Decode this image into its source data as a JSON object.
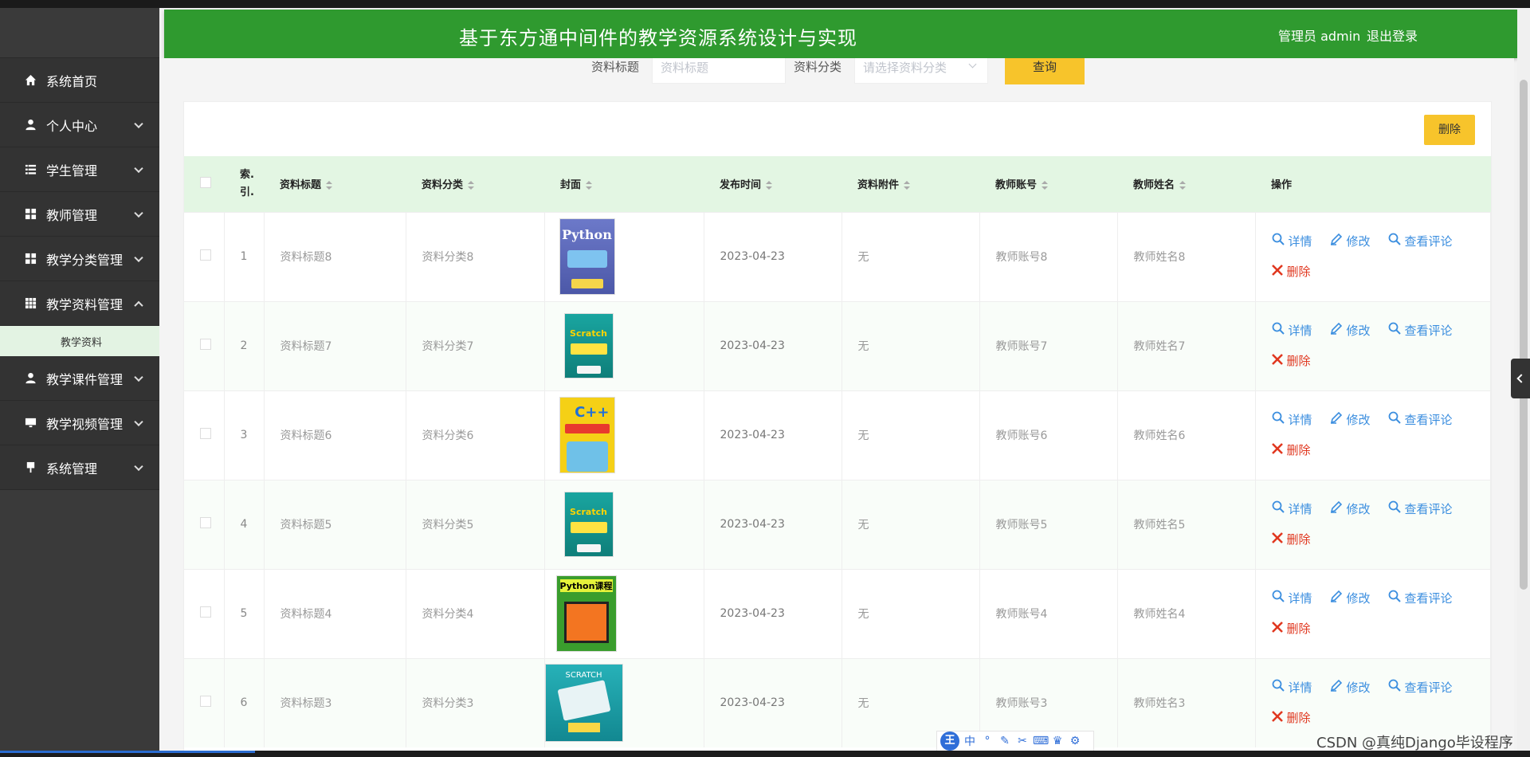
{
  "header": {
    "title": "基于东方通中间件的教学资源系统设计与实现",
    "user": "管理员 admin",
    "logout": "退出登录"
  },
  "sidebar": {
    "items": [
      {
        "label": "系统首页",
        "icon": "home-icon",
        "chevron": "none"
      },
      {
        "label": "个人中心",
        "icon": "person-icon",
        "chevron": "down"
      },
      {
        "label": "学生管理",
        "icon": "list-icon",
        "chevron": "down"
      },
      {
        "label": "教师管理",
        "icon": "grid-icon",
        "chevron": "down"
      },
      {
        "label": "教学分类管理",
        "icon": "grid-icon",
        "chevron": "down"
      },
      {
        "label": "教学资料管理",
        "icon": "table-icon",
        "chevron": "up"
      },
      {
        "label": "教学课件管理",
        "icon": "person-icon",
        "chevron": "down"
      },
      {
        "label": "教学视频管理",
        "icon": "monitor-icon",
        "chevron": "down"
      },
      {
        "label": "系统管理",
        "icon": "sign-icon",
        "chevron": "down"
      }
    ],
    "submenu_active": "教学资料"
  },
  "search": {
    "title_label": "资料标题",
    "title_placeholder": "资料标题",
    "category_label": "资料分类",
    "category_placeholder": "请选择资料分类",
    "query_button": "查询"
  },
  "toolbar": {
    "delete_label": "删除"
  },
  "table": {
    "headers": [
      "索.引.",
      "资料标题",
      "资料分类",
      "封面",
      "发布时间",
      "资料附件",
      "教师账号",
      "教师姓名",
      "操作"
    ],
    "index_line1": "索.",
    "index_line2": "引.",
    "rows": [
      {
        "index": "1",
        "title": "资料标题8",
        "category": "资料分类8",
        "cover": "Python",
        "date": "2023-04-23",
        "attachment": "无",
        "account": "教师账号8",
        "name": "教师姓名8"
      },
      {
        "index": "2",
        "title": "资料标题7",
        "category": "资料分类7",
        "cover": "Scratch",
        "date": "2023-04-23",
        "attachment": "无",
        "account": "教师账号7",
        "name": "教师姓名7"
      },
      {
        "index": "3",
        "title": "资料标题6",
        "category": "资料分类6",
        "cover": "C++",
        "date": "2023-04-23",
        "attachment": "无",
        "account": "教师账号6",
        "name": "教师姓名6"
      },
      {
        "index": "4",
        "title": "资料标题5",
        "category": "资料分类5",
        "cover": "Scratch",
        "date": "2023-04-23",
        "attachment": "无",
        "account": "教师账号5",
        "name": "教师姓名5"
      },
      {
        "index": "5",
        "title": "资料标题4",
        "category": "资料分类4",
        "cover": "Python课程",
        "date": "2023-04-23",
        "attachment": "无",
        "account": "教师账号4",
        "name": "教师姓名4"
      },
      {
        "index": "6",
        "title": "资料标题3",
        "category": "资料分类3",
        "cover": "SCRATCH",
        "date": "2023-04-23",
        "attachment": "无",
        "account": "教师账号3",
        "name": "教师姓名3"
      }
    ],
    "ops": {
      "detail": "详情",
      "edit": "修改",
      "comments": "查看评论",
      "delete": "删除"
    }
  },
  "ime": {
    "logo": "王",
    "mode": "中"
  },
  "watermark": "CSDN @真纯Django毕设程序",
  "colors": {
    "header_bg": "#2f9a2f",
    "sidebar_bg": "#333333",
    "accent_yellow": "#f7c42b",
    "link_blue": "#3b8edf",
    "delete_red": "#e0371f",
    "table_header_bg": "#e3f6e3"
  }
}
